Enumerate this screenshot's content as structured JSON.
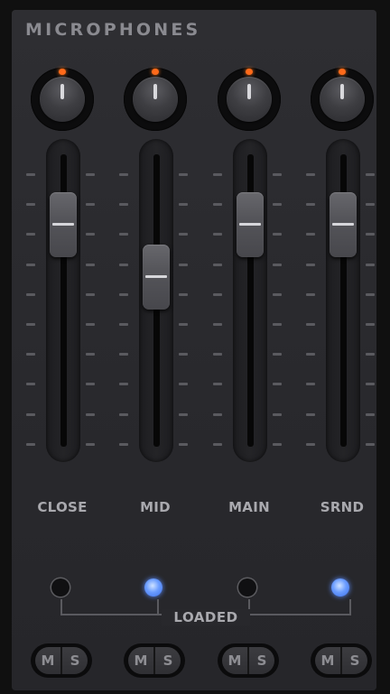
{
  "panel": {
    "title": "MICROPHONES",
    "group_label": "LOADED"
  },
  "channels": [
    {
      "label": "CLOSE",
      "fader_level": 0.76,
      "loaded": false,
      "mute_label": "M",
      "solo_label": "S"
    },
    {
      "label": "MID",
      "fader_level": 0.58,
      "loaded": true,
      "mute_label": "M",
      "solo_label": "S"
    },
    {
      "label": "MAIN",
      "fader_level": 0.76,
      "loaded": false,
      "mute_label": "M",
      "solo_label": "S"
    },
    {
      "label": "SRND",
      "fader_level": 0.76,
      "loaded": true,
      "mute_label": "M",
      "solo_label": "S"
    }
  ],
  "colors": {
    "knob_led": "#ff6a1a",
    "loaded_led": "#6a9cff"
  }
}
